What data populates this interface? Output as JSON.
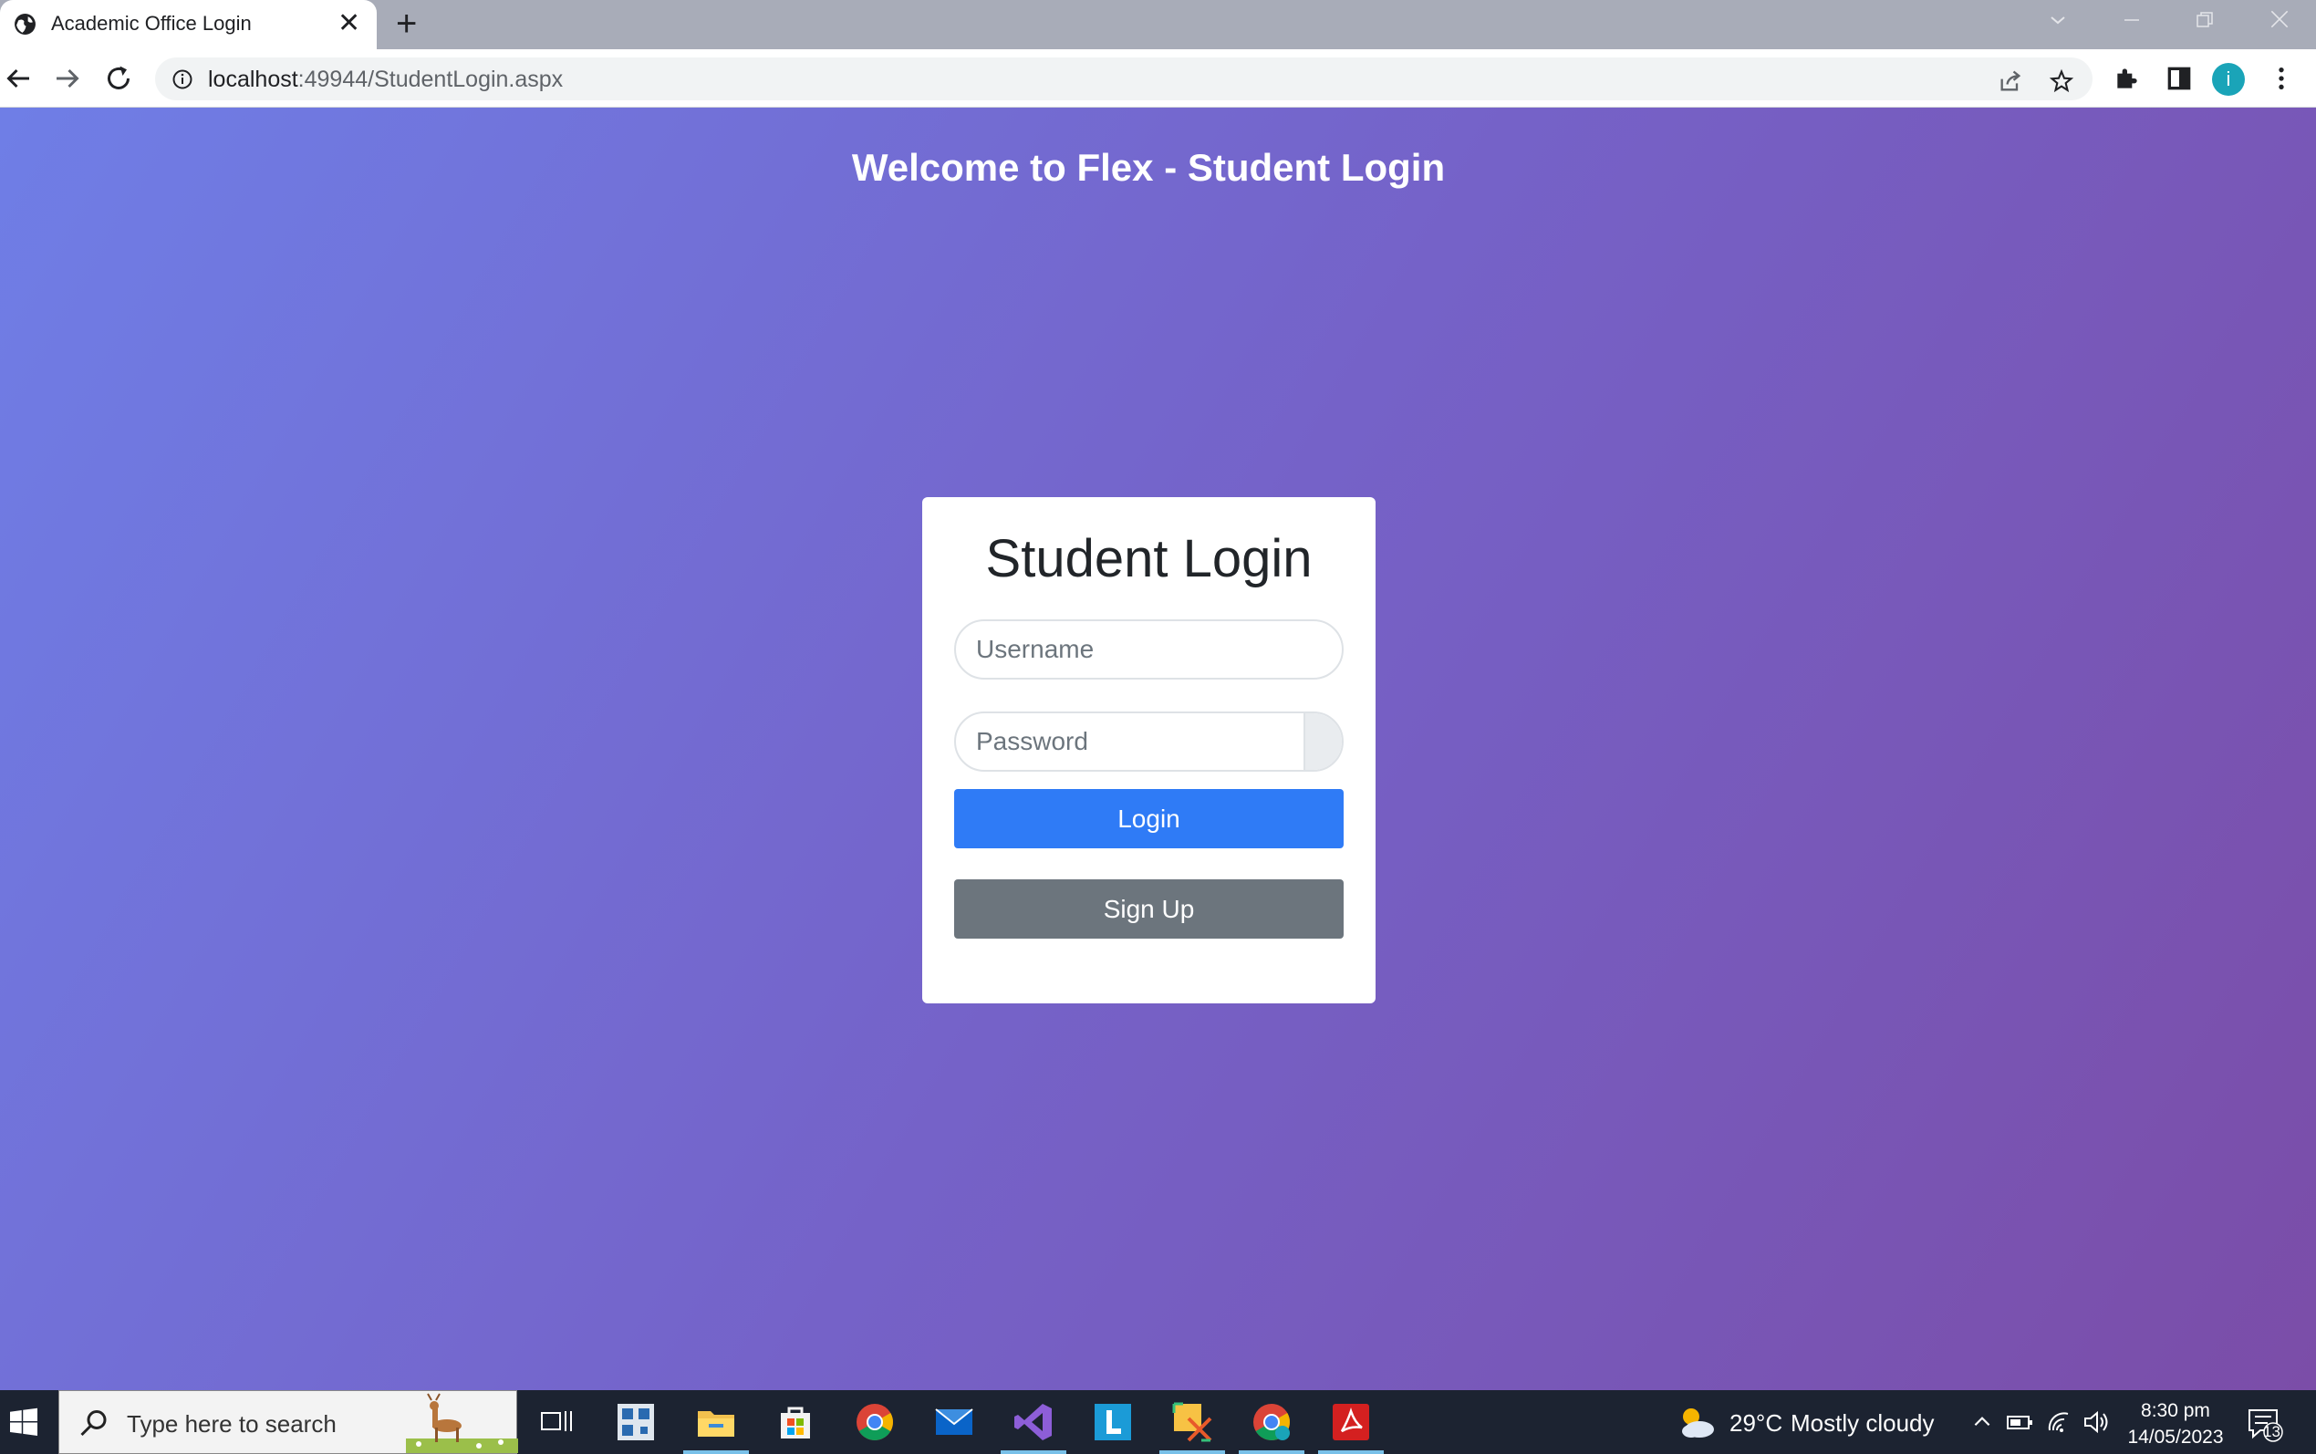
{
  "browser": {
    "tab_title": "Academic Office Login",
    "tab_close": "✕",
    "new_tab": "+",
    "url_host": "localhost",
    "url_rest": ":49944/StudentLogin.aspx",
    "profile_initial": "i"
  },
  "page": {
    "welcome": "Welcome to Flex - Student Login",
    "card_title": "Student Login",
    "username_placeholder": "Username",
    "password_placeholder": "Password",
    "login_label": "Login",
    "signup_label": "Sign Up"
  },
  "taskbar": {
    "search_placeholder": "Type here to search",
    "weather_temp": "29°C",
    "weather_desc": "Mostly cloudy",
    "time": "8:30 pm",
    "date": "14/05/2023",
    "notification_count": "13"
  },
  "colors": {
    "login_button": "#2f7bf6",
    "signup_button": "#6c757d",
    "gradient_start": "#6f7ee6",
    "gradient_end": "#7b4da8"
  }
}
